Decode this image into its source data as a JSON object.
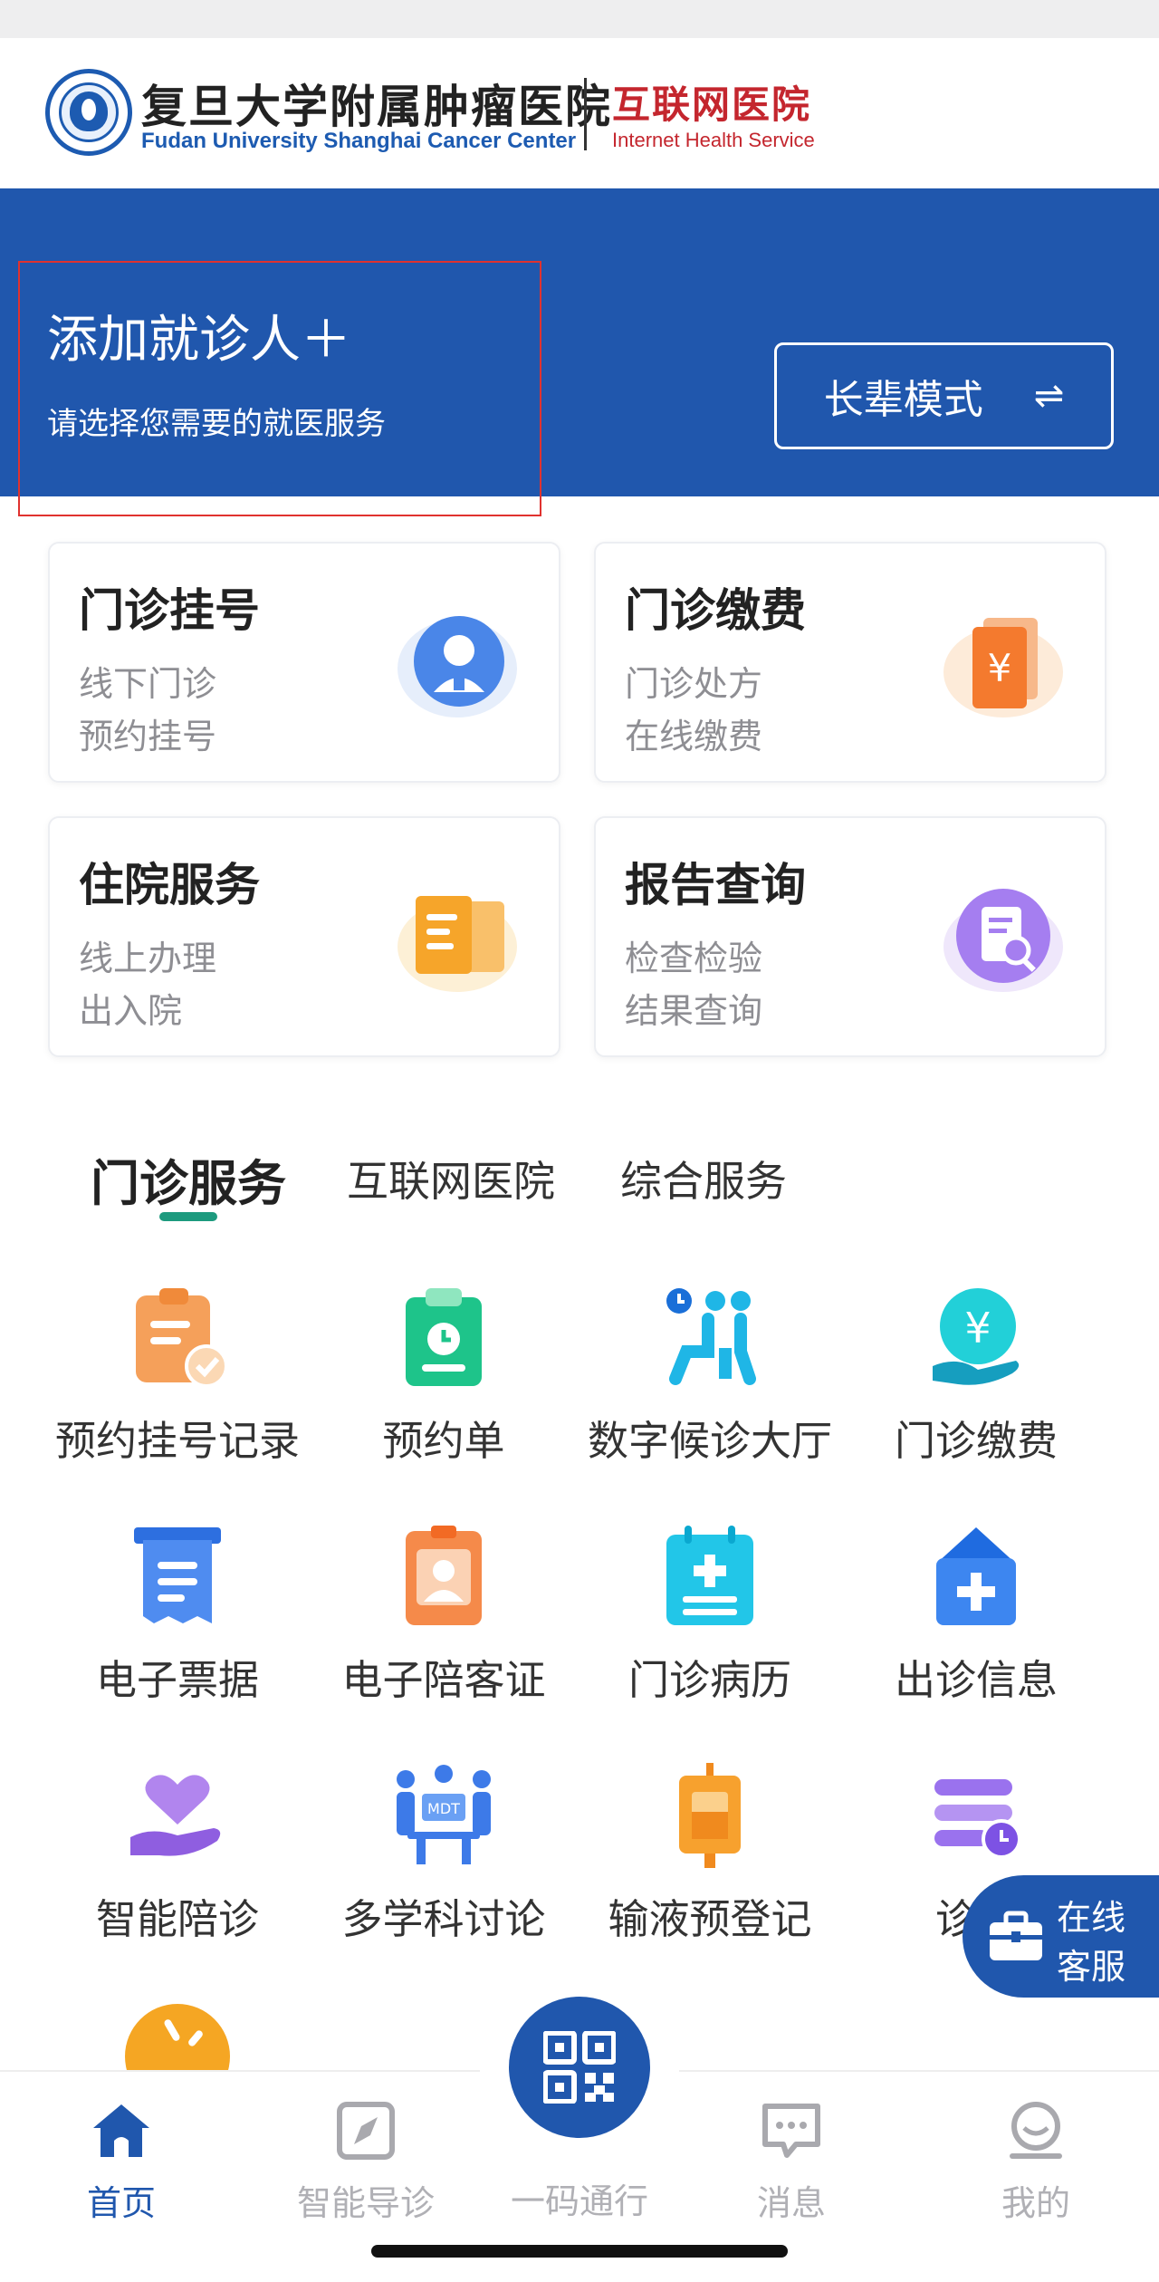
{
  "header": {
    "hospital_name_cn": "复旦大学附属肿瘤医院",
    "hospital_name_en": "Fudan University Shanghai Cancer Center",
    "service_cn": "互联网医院",
    "service_en": "Internet Health Service"
  },
  "banner": {
    "add_patient": "添加就诊人＋",
    "hint": "请选择您需要的就医服务",
    "elder_mode": "长辈模式",
    "elder_mode_icon": "⇌"
  },
  "cards": [
    {
      "title": "门诊挂号",
      "line1": "线下门诊",
      "line2": "预约挂号",
      "icon": "doctor-icon"
    },
    {
      "title": "门诊缴费",
      "line1": "门诊处方",
      "line2": "在线缴费",
      "icon": "yuan-icon"
    },
    {
      "title": "住院服务",
      "line1": "线上办理",
      "line2": "出入院",
      "icon": "document-icon"
    },
    {
      "title": "报告查询",
      "line1": "检查检验",
      "line2": "结果查询",
      "icon": "report-search-icon"
    }
  ],
  "tabs": [
    {
      "label": "门诊服务",
      "active": true
    },
    {
      "label": "互联网医院",
      "active": false
    },
    {
      "label": "综合服务",
      "active": false
    }
  ],
  "services": [
    {
      "label": "预约挂号记录",
      "icon": "clipboard-check-icon"
    },
    {
      "label": "预约单",
      "icon": "clock-clipboard-icon"
    },
    {
      "label": "数字候诊大厅",
      "icon": "waiting-room-icon"
    },
    {
      "label": "门诊缴费",
      "icon": "yuan-hand-icon"
    },
    {
      "label": "电子票据",
      "icon": "receipt-icon"
    },
    {
      "label": "电子陪客证",
      "icon": "id-badge-icon"
    },
    {
      "label": "门诊病历",
      "icon": "medical-record-icon"
    },
    {
      "label": "出诊信息",
      "icon": "clinic-house-icon"
    },
    {
      "label": "智能陪诊",
      "icon": "heart-hand-icon"
    },
    {
      "label": "多学科讨论",
      "icon": "mdt-meeting-icon"
    },
    {
      "label": "输液预登记",
      "icon": "infusion-bag-icon"
    },
    {
      "label": "诊前",
      "icon": "pre-visit-icon"
    }
  ],
  "mdt_text": "MDT",
  "float_service": {
    "line1": "在线",
    "line2": "客服"
  },
  "bottom_nav": [
    {
      "label": "首页",
      "active": true
    },
    {
      "label": "智能导诊",
      "active": false
    },
    {
      "label": "一码通行",
      "active": false
    },
    {
      "label": "消息",
      "active": false
    },
    {
      "label": "我的",
      "active": false
    }
  ],
  "colors": {
    "primary": "#2057ad",
    "tab_underline": "#1d9a7e",
    "highlight_box": "#e0322f",
    "brand_red": "#c4262e"
  }
}
